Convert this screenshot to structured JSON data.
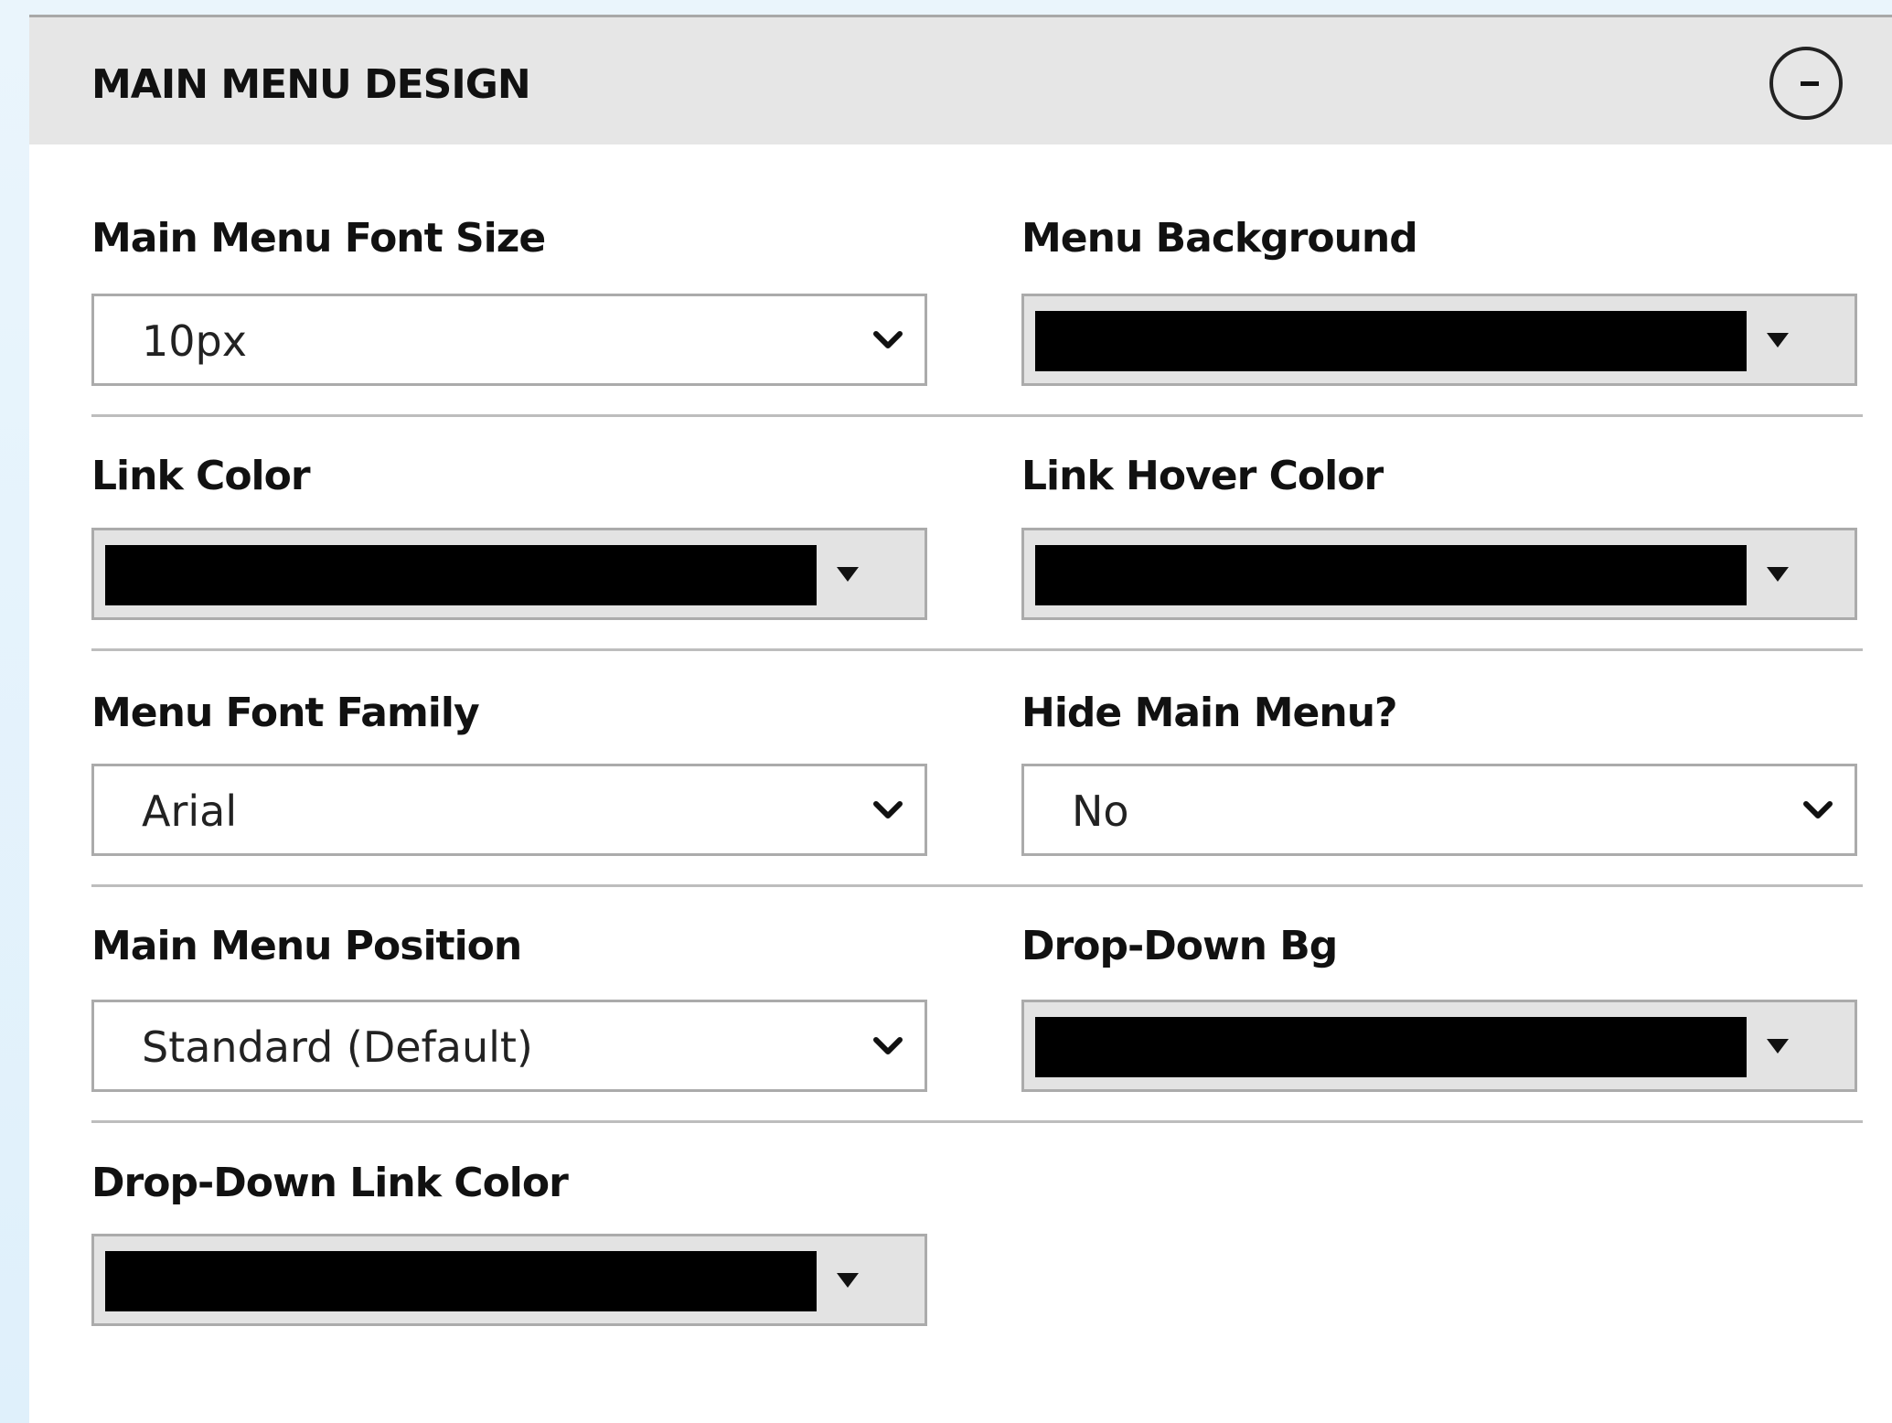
{
  "panel": {
    "title": "MAIN MENU DESIGN",
    "collapse_icon": "minus-circle-icon"
  },
  "fields": {
    "main_menu_font_size": {
      "label": "Main Menu Font Size",
      "value": "10px"
    },
    "menu_background": {
      "label": "Menu Background",
      "color": "#000000"
    },
    "link_color": {
      "label": "Link Color",
      "color": "#000000"
    },
    "link_hover_color": {
      "label": "Link Hover Color",
      "color": "#000000"
    },
    "menu_font_family": {
      "label": "Menu Font Family",
      "value": "Arial"
    },
    "hide_main_menu": {
      "label": "Hide Main Menu?",
      "value": "No"
    },
    "main_menu_position": {
      "label": "Main Menu Position",
      "value": "Standard (Default)"
    },
    "drop_down_bg": {
      "label": "Drop-Down Bg",
      "color": "#000000"
    },
    "drop_down_link_color": {
      "label": "Drop-Down Link Color",
      "color": "#000000"
    }
  },
  "icons": {
    "select_arrow": "chevron-down-icon",
    "color_arrow": "triangle-down-icon"
  }
}
